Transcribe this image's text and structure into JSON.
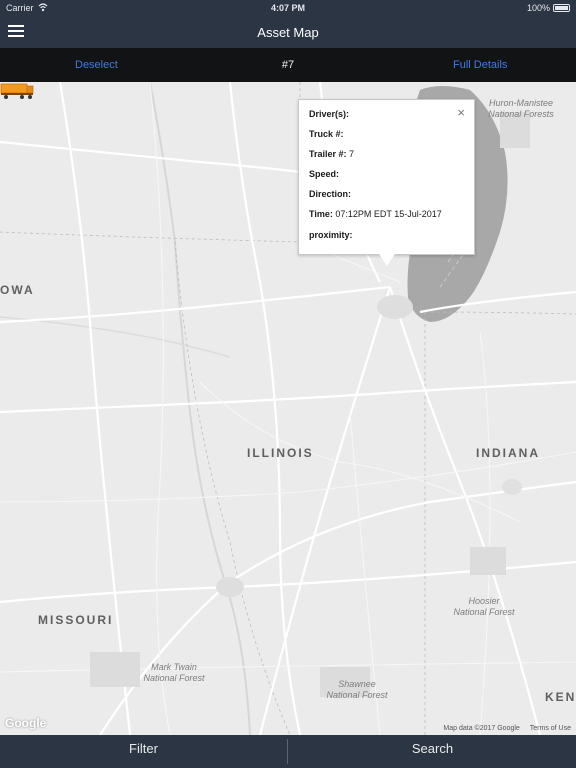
{
  "status_bar": {
    "carrier": "Carrier",
    "time": "4:07 PM",
    "battery": "100%",
    "wifi_icon": "wifi-icon",
    "battery_icon": "battery-icon"
  },
  "nav": {
    "title": "Asset Map",
    "menu_icon": "hamburger-menu-icon"
  },
  "subbar": {
    "deselect": "Deselect",
    "selected_id": "#7",
    "full_details": "Full Details"
  },
  "popup": {
    "close": "×",
    "drivers_label": "Driver(s):",
    "drivers_value": "",
    "truck_label": "Truck #:",
    "truck_value": "",
    "trailer_label": "Trailer #:",
    "trailer_value": "7",
    "speed_label": "Speed:",
    "speed_value": "",
    "direction_label": "Direction:",
    "direction_value": "",
    "time_label": "Time:",
    "time_value": "07:12PM EDT 15-Jul-2017",
    "proximity_label": "proximity:",
    "proximity_value": ""
  },
  "map": {
    "labels": {
      "iowa": "OWA",
      "illinois": "ILLINOIS",
      "indiana": "INDIANA",
      "missouri": "MISSOURI",
      "kentucky": "KEN",
      "huron_manistee": "Huron-Manistee\nNational Forests",
      "hoosier": "Hoosier\nNational Forest",
      "mark_twain": "Mark Twain\nNational Forest",
      "shawnee": "Shawnee\nNational Forest"
    },
    "google": "Google",
    "map_data": "Map data ©2017 Google",
    "terms": "Terms of Use",
    "colors": {
      "lake": "#a6a6a6",
      "land": "#ebebeb",
      "roads": "#ffffff",
      "truck": "#f39a1e"
    }
  },
  "bottom": {
    "filter": "Filter",
    "search": "Search"
  }
}
